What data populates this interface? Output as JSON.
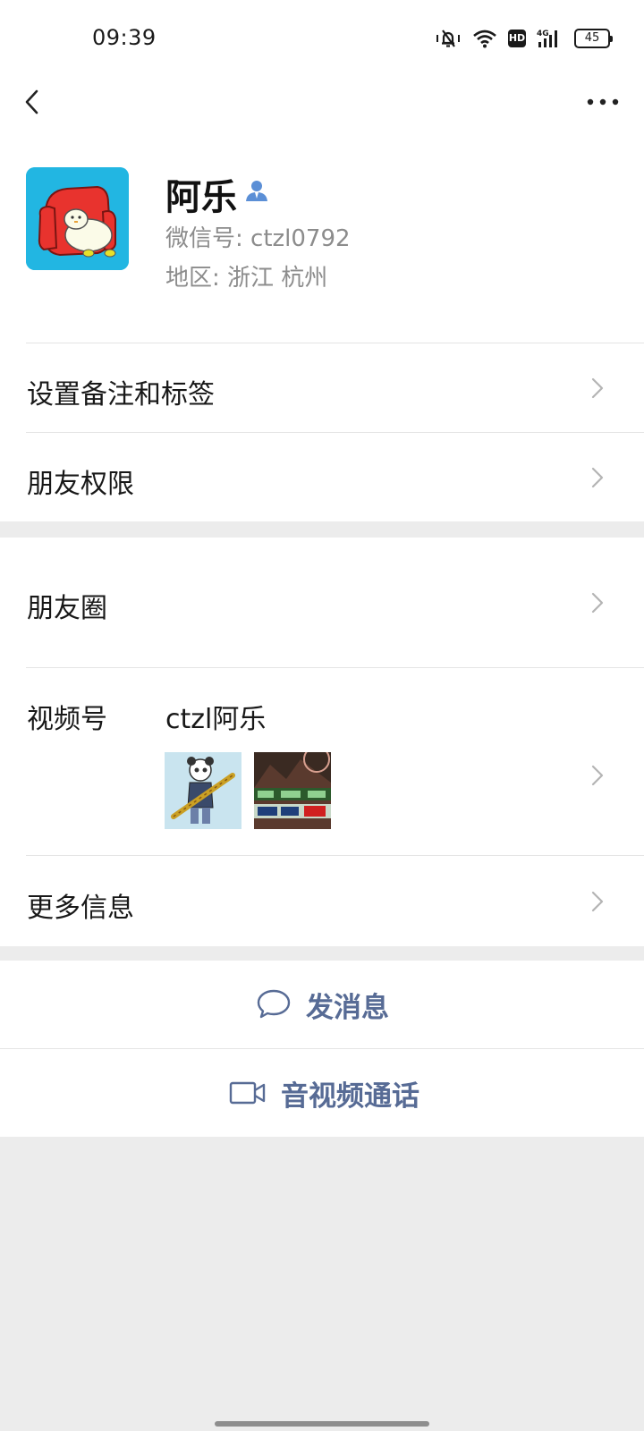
{
  "status_bar": {
    "time": "09:39",
    "battery": "45",
    "network": "4G",
    "hd_label": "HD",
    "icons": [
      "mute-vibrate-icon",
      "wifi-icon",
      "hd-icon",
      "signal-icon",
      "battery-icon"
    ]
  },
  "nav": {
    "back_icon": "chevron-left-icon",
    "more_icon": "more-dots-icon"
  },
  "profile": {
    "name": "阿乐",
    "wechat_id": "微信号: ctzl0792",
    "region": "地区: 浙江  杭州",
    "verified_icon": "contact-person-icon"
  },
  "rows": {
    "remark": "设置备注和标签",
    "permissions": "朋友权限",
    "moments": "朋友圈",
    "channels": "视频号",
    "channels_name": "ctzl阿乐",
    "more_info": "更多信息"
  },
  "actions": {
    "message": "发消息",
    "call": "音视频通话"
  },
  "colors": {
    "link_blue": "#576b95",
    "background": "#ececec",
    "avatar_bg": "#22b6e2"
  }
}
